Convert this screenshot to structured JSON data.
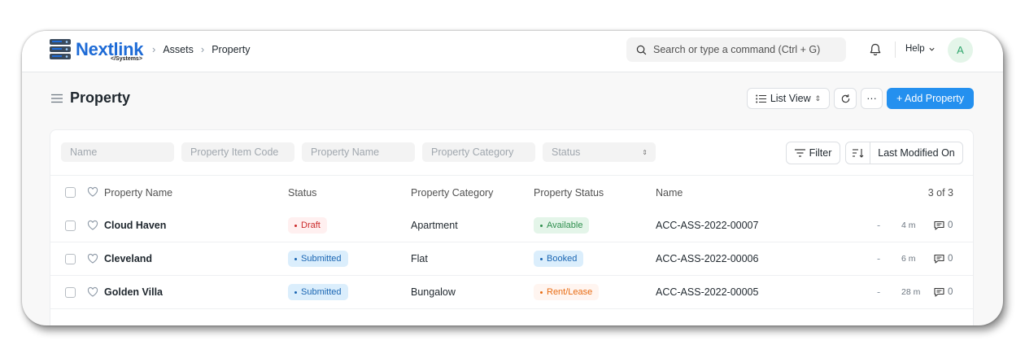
{
  "app": {
    "logo_text": "Nextlink",
    "logo_sub": "</Systems>",
    "breadcrumbs": [
      "Assets",
      "Property"
    ],
    "search_placeholder": "Search or type a command (Ctrl + G)",
    "help_label": "Help",
    "avatar_initial": "A",
    "accent_color": "#2490ef"
  },
  "page": {
    "title": "Property",
    "list_view_label": "List View",
    "more_label": "···",
    "add_label": "+ Add Property"
  },
  "filters": {
    "name_placeholder": "Name",
    "item_code_placeholder": "Property Item Code",
    "property_name_placeholder": "Property Name",
    "category_placeholder": "Property Category",
    "status_placeholder": "Status",
    "filter_label": "Filter",
    "sort_label": "Last Modified On"
  },
  "table": {
    "headers": {
      "property_name": "Property Name",
      "status": "Status",
      "category": "Property Category",
      "property_status": "Property Status",
      "name": "Name",
      "count": "3 of 3"
    },
    "rows": [
      {
        "property_name": "Cloud Haven",
        "status": "Draft",
        "status_color": "#cb2929",
        "status_bg": "#fff0f0",
        "category": "Apartment",
        "property_status": "Available",
        "property_status_color": "#2f8f4e",
        "property_status_bg": "#e4f5e9",
        "name": "ACC-ASS-2022-00007",
        "dash": "-",
        "modified": "4 m",
        "comments": "0"
      },
      {
        "property_name": "Cleveland",
        "status": "Submitted",
        "status_color": "#1a66b3",
        "status_bg": "#dbeefc",
        "category": "Flat",
        "property_status": "Booked",
        "property_status_color": "#1a66b3",
        "property_status_bg": "#dbeefc",
        "name": "ACC-ASS-2022-00006",
        "dash": "-",
        "modified": "6 m",
        "comments": "0"
      },
      {
        "property_name": "Golden Villa",
        "status": "Submitted",
        "status_color": "#1a66b3",
        "status_bg": "#dbeefc",
        "category": "Bungalow",
        "property_status": "Rent/Lease",
        "property_status_color": "#e86c13",
        "property_status_bg": "#fff5f0",
        "name": "ACC-ASS-2022-00005",
        "dash": "-",
        "modified": "28 m",
        "comments": "0"
      }
    ]
  }
}
